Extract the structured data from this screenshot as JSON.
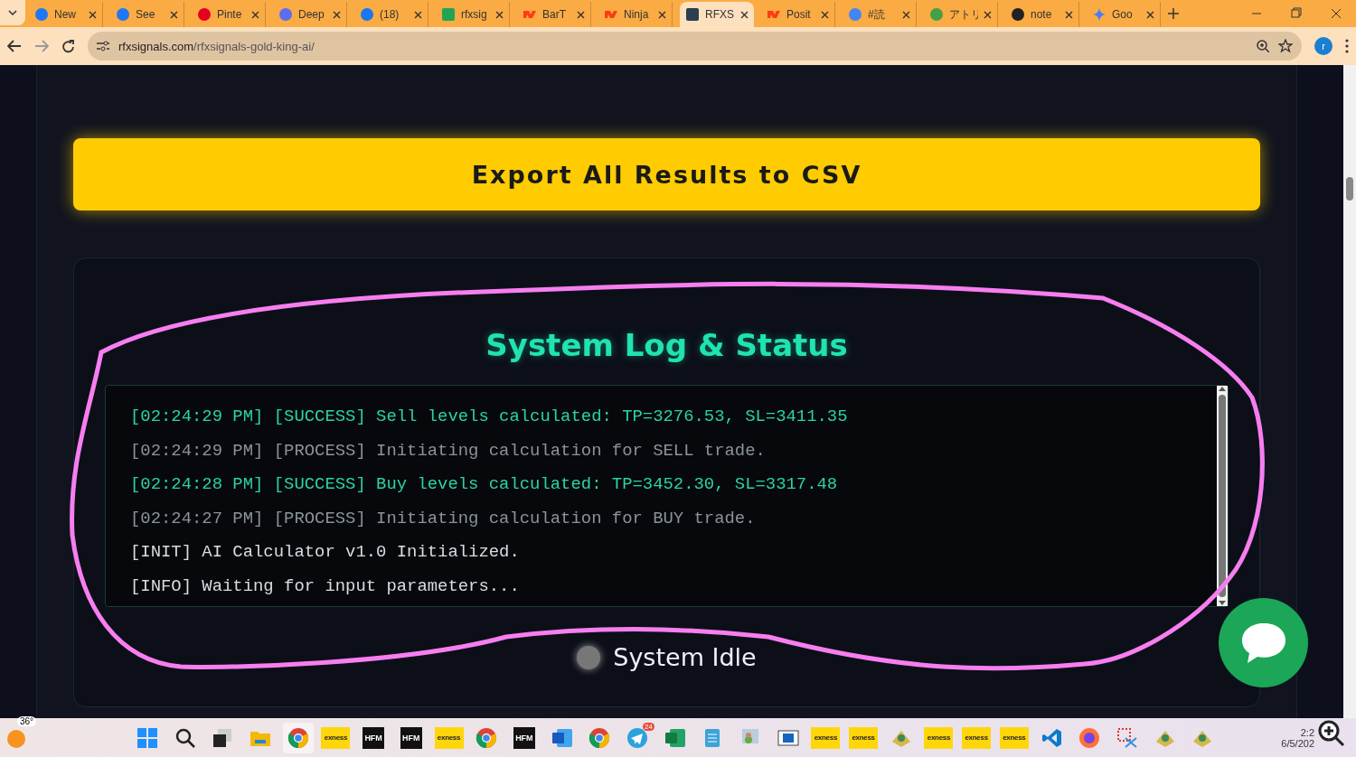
{
  "browser": {
    "tabs": [
      {
        "label": "New",
        "selected": false
      },
      {
        "label": "See",
        "selected": false
      },
      {
        "label": "Pinte",
        "selected": false
      },
      {
        "label": "Deep",
        "selected": false
      },
      {
        "label": "(18)",
        "selected": false
      },
      {
        "label": "rfxsig",
        "selected": false
      },
      {
        "label": "BarT",
        "selected": false
      },
      {
        "label": "Ninja",
        "selected": false
      },
      {
        "label": "RFXS",
        "selected": true
      },
      {
        "label": "Posit",
        "selected": false
      },
      {
        "label": "#読",
        "selected": false
      },
      {
        "label": "アトリ",
        "selected": false
      },
      {
        "label": "note",
        "selected": false
      },
      {
        "label": "Goo",
        "selected": false
      }
    ],
    "address": {
      "domain": "rfxsignals.com",
      "path": "/rfxsignals-gold-king-ai/"
    },
    "profile": "r"
  },
  "page": {
    "export_button": "Export All Results to CSV",
    "log_panel": {
      "title": "System Log & Status",
      "lines": [
        {
          "kind": "success",
          "text": "[02:24:29 PM] [SUCCESS] Sell levels calculated: TP=3276.53, SL=3411.35"
        },
        {
          "kind": "process",
          "text": "[02:24:29 PM] [PROCESS] Initiating calculation for SELL trade."
        },
        {
          "kind": "success",
          "text": "[02:24:28 PM] [SUCCESS] Buy levels calculated: TP=3452.30, SL=3317.48"
        },
        {
          "kind": "process",
          "text": "[02:24:27 PM] [PROCESS] Initiating calculation for BUY trade."
        },
        {
          "kind": "info",
          "text": "[INIT] AI Calculator v1.0 Initialized."
        },
        {
          "kind": "info",
          "text": "[INFO] Waiting for input parameters..."
        }
      ],
      "status": {
        "label": "System Idle",
        "active": false
      }
    }
  },
  "taskbar": {
    "weather": "36°",
    "apps": [
      {
        "kind": "windows"
      },
      {
        "kind": "search"
      },
      {
        "kind": "taskview"
      },
      {
        "kind": "folder"
      },
      {
        "kind": "chrome",
        "selected": true
      },
      {
        "kind": "exness",
        "label": "exness"
      },
      {
        "kind": "hfm",
        "label": "HFM"
      },
      {
        "kind": "hfm",
        "label": "HFM"
      },
      {
        "kind": "exness",
        "label": "exness"
      },
      {
        "kind": "chrome",
        "selected": false
      },
      {
        "kind": "hfm",
        "label": "HFM"
      },
      {
        "kind": "word"
      },
      {
        "kind": "chrome",
        "selected": false
      },
      {
        "kind": "telegram",
        "badge": "24"
      },
      {
        "kind": "excel"
      },
      {
        "kind": "notepad"
      },
      {
        "kind": "people"
      },
      {
        "kind": "window"
      },
      {
        "kind": "exness",
        "label": "exness"
      },
      {
        "kind": "exness",
        "label": "exness"
      },
      {
        "kind": "mt"
      },
      {
        "kind": "exness",
        "label": "exness"
      },
      {
        "kind": "exness",
        "label": "exness"
      },
      {
        "kind": "exness",
        "label": "exness"
      },
      {
        "kind": "vscode"
      },
      {
        "kind": "firefox"
      },
      {
        "kind": "snip"
      },
      {
        "kind": "mt"
      },
      {
        "kind": "mt"
      }
    ],
    "time": "2:2",
    "date": "6/5/202"
  }
}
